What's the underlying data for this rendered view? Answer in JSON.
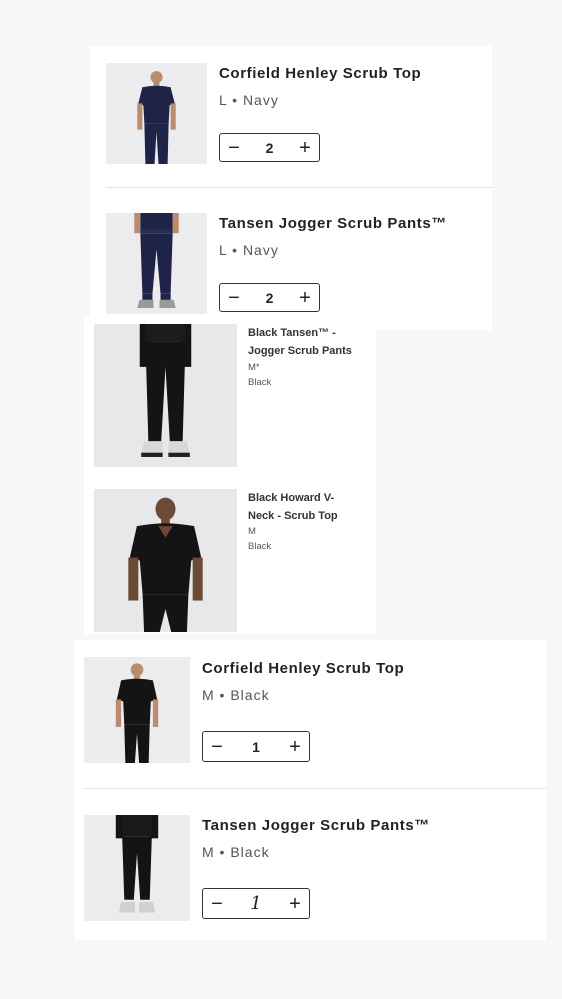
{
  "cart_top": {
    "items": [
      {
        "title": "Corfield Henley Scrub Top",
        "variant": "L • Navy",
        "quantity": "2",
        "decrease_icon": "minus-icon",
        "increase_icon": "plus-icon",
        "image_icon": "product-photo-navy-top"
      },
      {
        "title": "Tansen Jogger Scrub Pants™",
        "variant": "L • Navy",
        "quantity": "2",
        "decrease_icon": "minus-icon",
        "increase_icon": "plus-icon",
        "image_icon": "product-photo-navy-pants"
      }
    ]
  },
  "order_summary": {
    "items": [
      {
        "title_line1": "Black Tansen™ -",
        "title_line2": "Jogger Scrub Pants",
        "size": "M*",
        "color": "Black",
        "image_icon": "product-photo-black-pants"
      },
      {
        "title_line1": "Black Howard V-",
        "title_line2": "Neck - Scrub Top",
        "size": "M",
        "color": "Black",
        "image_icon": "product-photo-black-vneck"
      }
    ]
  },
  "cart_bottom": {
    "items": [
      {
        "title": "Corfield Henley Scrub Top",
        "variant": "M • Black",
        "quantity": "1",
        "decrease_icon": "minus-icon",
        "increase_icon": "plus-icon",
        "image_icon": "product-photo-black-top"
      },
      {
        "title": "Tansen Jogger Scrub Pants™",
        "variant": "M • Black",
        "quantity": "1",
        "decrease_icon": "minus-icon",
        "increase_icon": "plus-icon",
        "image_icon": "product-photo-black-pants"
      }
    ]
  },
  "colors": {
    "navy": "#1f2347",
    "black": "#141414",
    "skin": "#b98c6e",
    "photo_bg": "#ececef"
  }
}
